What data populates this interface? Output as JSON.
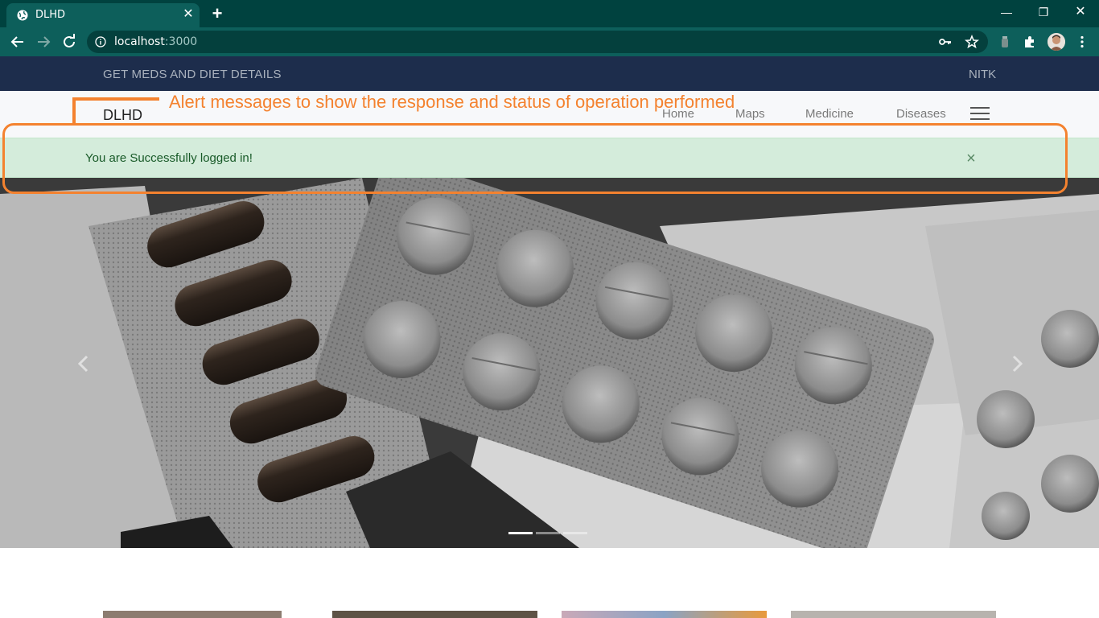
{
  "browser": {
    "tab_title": "DLHD",
    "url_host": "localhost",
    "url_port": ":3000"
  },
  "site": {
    "topbar_left": "GET MEDS AND DIET DETAILS",
    "topbar_right": "NITK",
    "brand": "DLHD",
    "nav": [
      "Home",
      "Maps",
      "Medicine",
      "Diseases"
    ]
  },
  "alert": {
    "message": "You are Successfully logged in!",
    "close_symbol": "×"
  },
  "annotation": {
    "text": "Alert messages to show the response and status of operation performed",
    "color": "#f4822f"
  },
  "carousel": {
    "slides": 3,
    "active_slide": 1
  },
  "colors": {
    "browser_frame": "#00423f",
    "site_topbar": "#1d2d4c",
    "alert_bg": "#d4ecdb",
    "alert_text": "#185a28"
  }
}
